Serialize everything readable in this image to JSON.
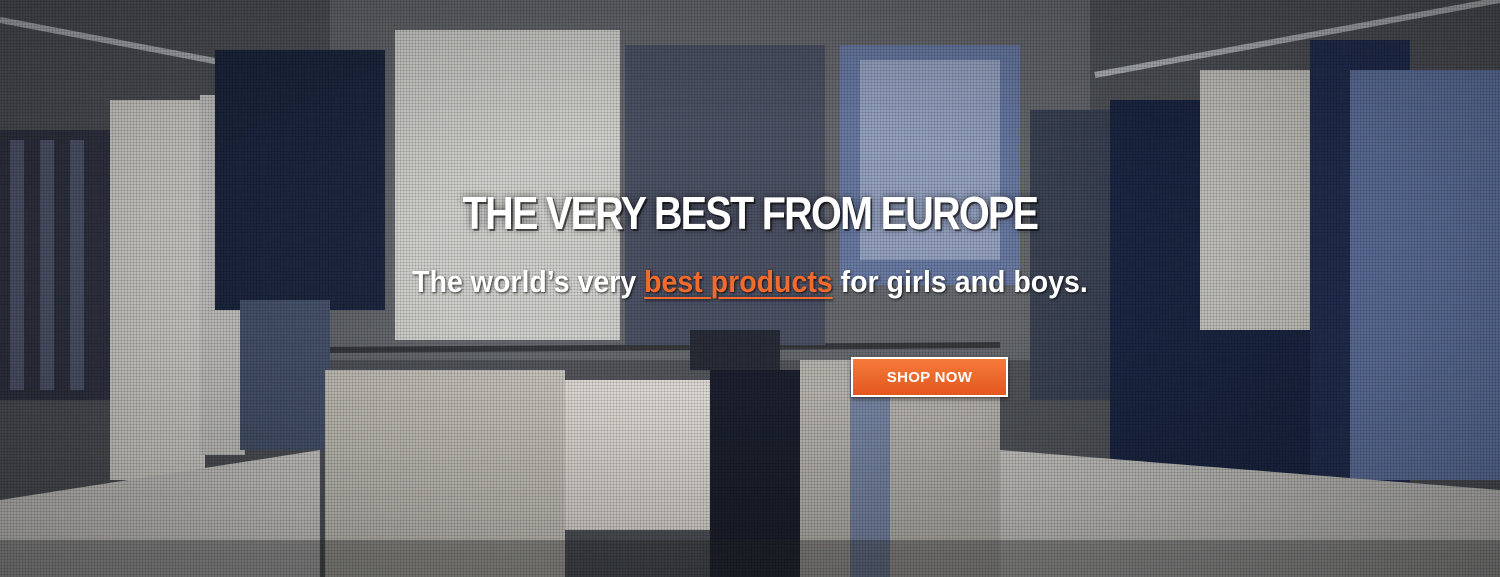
{
  "banner": {
    "headline": "THE VERY BEST FROM EUROPE",
    "subline_before": "The world’s very ",
    "subline_highlight": "best products",
    "subline_after": " for girls and boys.",
    "cta_label": "SHOP NOW"
  },
  "colors": {
    "accent": "#f26a2c",
    "button": "#ec6528",
    "text": "#ffffff"
  }
}
